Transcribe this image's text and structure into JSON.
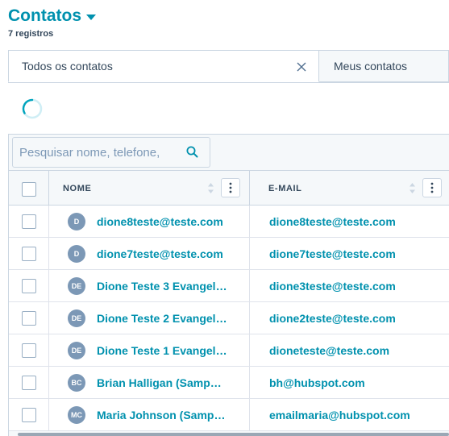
{
  "header": {
    "title": "Contatos",
    "record_count": "7 registros"
  },
  "tabs": [
    {
      "label": "Todos os contatos",
      "active": true
    },
    {
      "label": "Meus contatos",
      "active": false
    }
  ],
  "search": {
    "placeholder": "Pesquisar nome, telefone,"
  },
  "table": {
    "columns": [
      {
        "label": "NOME"
      },
      {
        "label": "E-MAIL"
      }
    ],
    "rows": [
      {
        "initials": "D",
        "name": "dione8teste@teste.com",
        "email": "dione8teste@teste.com"
      },
      {
        "initials": "D",
        "name": "dione7teste@teste.com",
        "email": "dione7teste@teste.com"
      },
      {
        "initials": "DE",
        "name": "Dione Teste 3 Evangel…",
        "email": "dione3teste@teste.com"
      },
      {
        "initials": "DE",
        "name": "Dione Teste 2 Evangel…",
        "email": "dione2teste@teste.com"
      },
      {
        "initials": "DE",
        "name": "Dione Teste 1 Evangel…",
        "email": "dioneteste@teste.com"
      },
      {
        "initials": "BC",
        "name": "Brian Halligan (Samp…",
        "email": "bh@hubspot.com"
      },
      {
        "initials": "MC",
        "name": "Maria Johnson (Samp…",
        "email": "emailmaria@hubspot.com"
      }
    ]
  },
  "colors": {
    "accent": "#0091ae",
    "text": "#33475b",
    "avatar_bg": "#7c98b6",
    "border": "#cbd6e2"
  }
}
